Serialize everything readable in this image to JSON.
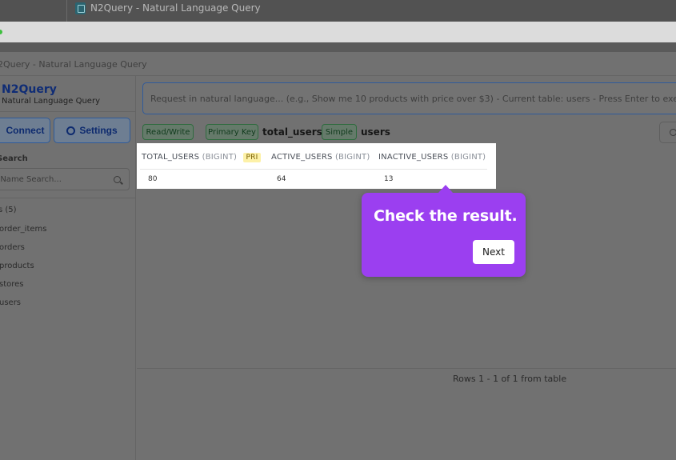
{
  "os_window": {
    "title": "N2Query - Natural Language Query"
  },
  "app": {
    "header_title": "2Query - Natural Language Query",
    "brand": {
      "name": "N2Query",
      "subtitle": "Natural Language Query"
    }
  },
  "sidebar": {
    "connect_label": "Connect",
    "settings_label": "Settings",
    "search_label": "Search",
    "search_placeholder": "e Name Search...",
    "tables_header": "s (5)",
    "tables": [
      "order_items",
      "orders",
      "products",
      "stores",
      "users"
    ]
  },
  "query": {
    "placeholder": "Request in natural language... (e.g., Show me 10 products with price over $3) - Current table: users - Press Enter to execute"
  },
  "badges": {
    "mode": "Read/Write",
    "key_label": "Primary Key",
    "key_value": "total_users",
    "table_label": "Simple",
    "table_value": "users"
  },
  "results": {
    "columns": [
      {
        "name": "TOTAL_USERS",
        "type": "(BIGINT)",
        "pri": "PRI"
      },
      {
        "name": "ACTIVE_USERS",
        "type": "(BIGINT)",
        "pri": ""
      },
      {
        "name": "INACTIVE_USERS",
        "type": "(BIGINT)",
        "pri": ""
      }
    ],
    "rows": [
      [
        "80",
        "64",
        "13"
      ]
    ],
    "footer": "Rows 1 - 1 of 1 from table"
  },
  "tour": {
    "message": "Check the result.",
    "next_label": "Next"
  },
  "colors": {
    "tour_bg": "#9b3ff0",
    "brand": "#0f2c75",
    "badge_green": "#2f6b3f",
    "pri_badge": "#fdf1a8"
  }
}
